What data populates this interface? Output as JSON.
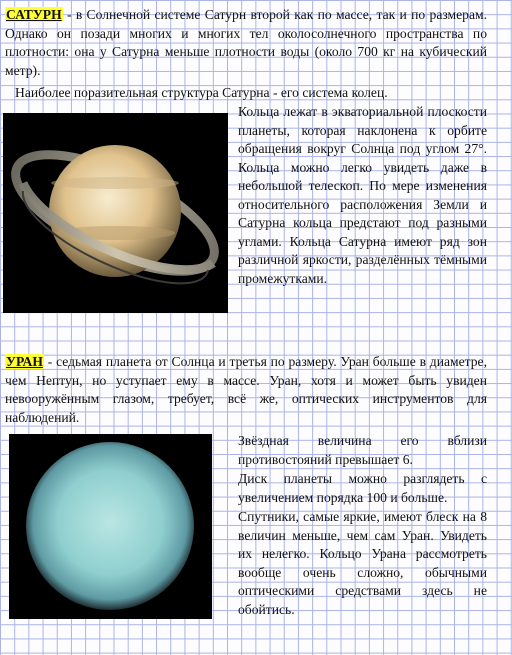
{
  "saturn": {
    "heading": "САТУРН",
    "intro": " -  в Солнечной системе Сатурн второй как по массе, так и по размерам. Однако он позади многих и многих тел околосолнечного пространства по плотности: она у Сатурна меньше плотности воды (около 700 кг на кубический метр).",
    "rings_lead": "Наиболее поразительная структура  Сатурна - его система колец.",
    "rings_text": "Кольца лежат в экваториальной плоскости планеты, которая наклонена к орбите обращения вокруг Солнца под углом 27°. Кольца можно легко увидеть даже в небольшой телескоп. По мере изменения относительного расположения Земли и Сатурна кольца предстают под разными углами. Кольца Сатурна имеют ряд зон различной яркости, разделённых тёмными промежутками."
  },
  "uranus": {
    "heading": "УРАН",
    "intro": " - седьмая планета от Солнца и третья по размеру. Уран больше в диаметре, чем Нептун, но уступает ему в массе. Уран, хотя и может быть увиден невооружённым глазом, требует, всё же, оптических инструментов для наблюдений.",
    "magnitude_text": "Звёздная величина его вблизи противостояний превышает 6.",
    "disk_text": "Диск планеты можно разглядеть с увеличением порядка 100 и больше.",
    "satellites_text": "Спутники, самые яркие, имеют блеск на 8 величин меньше, чем сам Уран. Увидеть их нелегко. Кольцо Урана рассмотреть вообще очень сложно, обычными оптическими средствами здесь не обойтись."
  },
  "colors": {
    "highlight": "#ffff33",
    "grid": "#aab3e6",
    "saturn_body": "#e8cfa0",
    "uranus_body": "#8fcfcf"
  }
}
